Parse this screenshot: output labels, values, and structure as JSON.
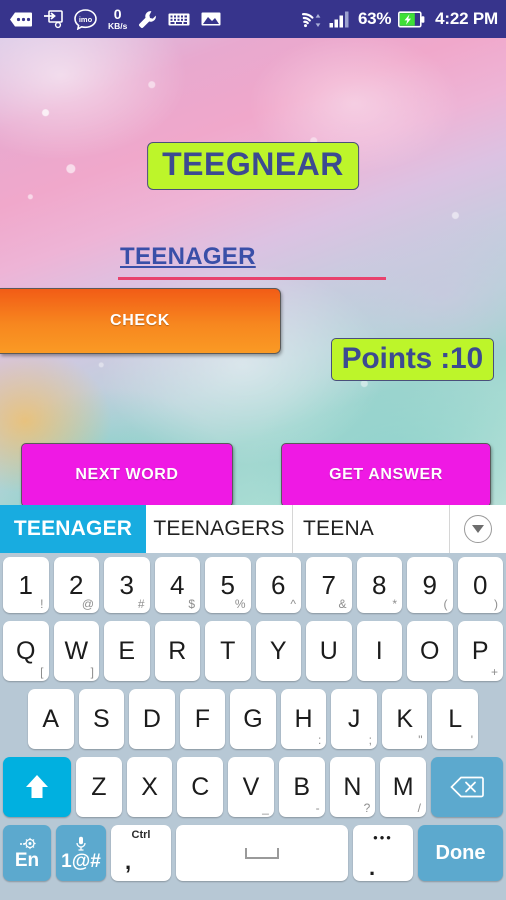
{
  "statusbar": {
    "icons": [
      "more-tag-icon",
      "screen-transfer-icon",
      "imo-icon",
      "wrench-icon",
      "keyboard-icon",
      "gallery-icon",
      "wifi-icon",
      "signal-icon"
    ],
    "imo_label": "imo",
    "net_speed_value": "0",
    "net_speed_unit": "KB/s",
    "battery_percent": "63%",
    "battery_state": "charging",
    "time": "4:22 PM",
    "bg_color": "#37348c"
  },
  "game": {
    "scrambled_word": "TEEGNEAR",
    "answer_value": "TEENAGER",
    "answer_placeholder": "",
    "check_label": "CHECK",
    "points_label": "Points :10",
    "next_word_label": "NEXT WORD",
    "get_answer_label": "GET ANSWER",
    "colors": {
      "badge_green": "#bdf52a",
      "badge_text": "#3c4a91",
      "check_orange": "#f7871f",
      "magenta": "#ef19e4",
      "underline_pink": "#e8426d",
      "answer_blue": "#3a4fa8"
    }
  },
  "keyboard": {
    "suggestions": [
      {
        "text": "TEENAGER",
        "active": true
      },
      {
        "text": "TEENAGERS",
        "active": false
      },
      {
        "text": "TEENA",
        "active": false
      }
    ],
    "expand_icon": "chevron-down-icon",
    "accent_color": "#18ace0",
    "row_numbers": [
      {
        "main": "1",
        "sub": "!"
      },
      {
        "main": "2",
        "sub": "@"
      },
      {
        "main": "3",
        "sub": "#"
      },
      {
        "main": "4",
        "sub": "$"
      },
      {
        "main": "5",
        "sub": "%"
      },
      {
        "main": "6",
        "sub": "^"
      },
      {
        "main": "7",
        "sub": "&"
      },
      {
        "main": "8",
        "sub": "*"
      },
      {
        "main": "9",
        "sub": "("
      },
      {
        "main": "0",
        "sub": ")"
      }
    ],
    "row_q": [
      {
        "main": "Q",
        "sub": "["
      },
      {
        "main": "W",
        "sub": "]"
      },
      {
        "main": "E",
        "sub": ""
      },
      {
        "main": "R",
        "sub": ""
      },
      {
        "main": "T",
        "sub": ""
      },
      {
        "main": "Y",
        "sub": ""
      },
      {
        "main": "U",
        "sub": ""
      },
      {
        "main": "I",
        "sub": ""
      },
      {
        "main": "O",
        "sub": ""
      },
      {
        "main": "P",
        "sub": "+"
      }
    ],
    "row_a": [
      {
        "main": "A",
        "sub": ""
      },
      {
        "main": "S",
        "sub": ""
      },
      {
        "main": "D",
        "sub": ""
      },
      {
        "main": "F",
        "sub": ""
      },
      {
        "main": "G",
        "sub": ""
      },
      {
        "main": "H",
        "sub": ":"
      },
      {
        "main": "J",
        "sub": ";"
      },
      {
        "main": "K",
        "sub": "\""
      },
      {
        "main": "L",
        "sub": "'"
      }
    ],
    "row_z": [
      {
        "main": "Z",
        "sub": ""
      },
      {
        "main": "X",
        "sub": ""
      },
      {
        "main": "C",
        "sub": ""
      },
      {
        "main": "V",
        "sub": "_"
      },
      {
        "main": "B",
        "sub": "-"
      },
      {
        "main": "N",
        "sub": "?"
      },
      {
        "main": "M",
        "sub": "/"
      }
    ],
    "shift_icon": "shift-up-arrow-icon",
    "backspace_icon": "backspace-icon",
    "bottom": {
      "lang_label": "En",
      "lang_icon": "gear-icon",
      "symbols_label": "1@#",
      "mic_icon": "microphone-icon",
      "comma_top": "Ctrl",
      "comma_main": ",",
      "space_icon": "spacebar-icon",
      "period_top": "•••",
      "period_main": ".",
      "done_label": "Done"
    }
  }
}
